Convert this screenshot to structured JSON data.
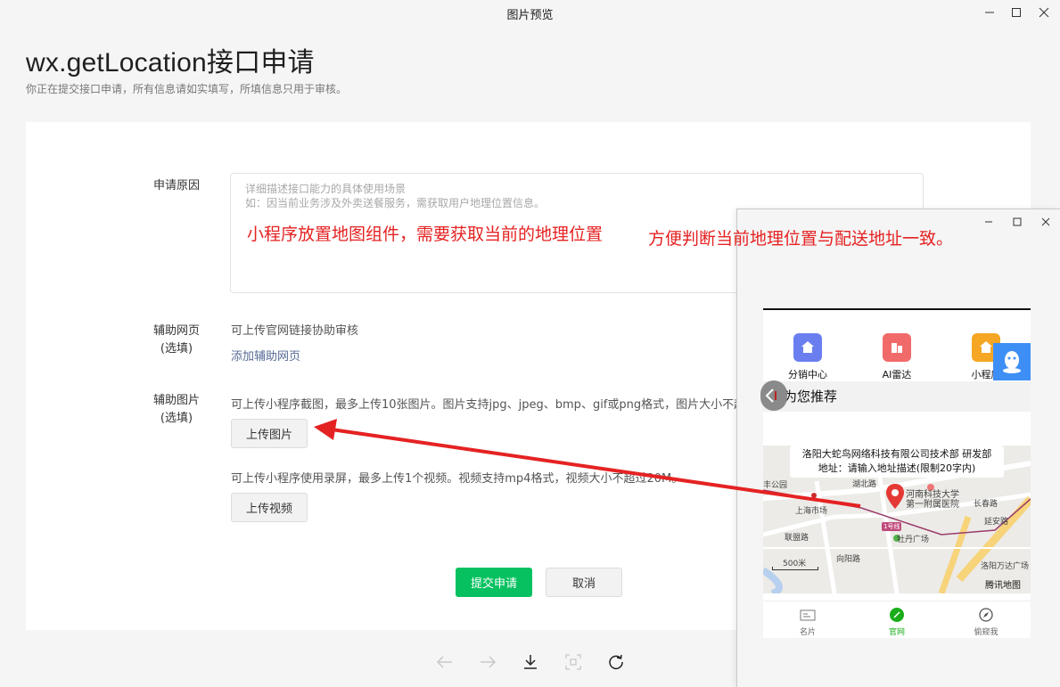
{
  "window": {
    "title": "图片预览"
  },
  "page": {
    "title": "wx.getLocation接口申请",
    "subtitle": "你正在提交接口申请，所有信息请如实填写，所填信息只用于审核。"
  },
  "form": {
    "reason_label": "申请原因",
    "reason_placeholder_1": "详细描述接口能力的具体使用场景",
    "reason_placeholder_2": "如：因当前业务涉及外卖送餐服务，需获取用户地理位置信息。",
    "reason_value_1": "小程序放置地图组件，需要获取当前的地理位置",
    "reason_value_2": "方便判断当前地理位置与配送地址一致。",
    "webpage_label_1": "辅助网页",
    "webpage_label_2": "(选填)",
    "webpage_help": "可上传官网链接协助审核",
    "webpage_link": "添加辅助网页",
    "image_label_1": "辅助图片",
    "image_label_2": "(选填)",
    "image_help": "可上传小程序截图，最多上传10张图片。图片支持jpg、jpeg、bmp、gif或png格式，图片大小不超过",
    "upload_image": "上传图片",
    "video_help": "可上传小程序使用录屏，最多上传1个视频。视频支持mp4格式，视频大小不超过20M。",
    "upload_video": "上传视频",
    "submit": "提交申请",
    "cancel": "取消"
  },
  "mini_app": {
    "apps": [
      "分销中心",
      "AI雷达",
      "小程序"
    ],
    "recommend_title": "为您推荐",
    "map_popup_line1": "洛阳大蛇鸟网络科技有限公司技术部 研发部",
    "map_popup_line2": "地址：请输入地址描述(限制20字内)",
    "map_labels": [
      "湖北路",
      "河南科技大学",
      "第一附属医院",
      "上海市场",
      "长春路",
      "牡丹广场",
      "联盟路",
      "延安路",
      "洛阳万达广场",
      "向阳路",
      "丰公园",
      "腾讯地图",
      "500米",
      "1号线"
    ],
    "tabs": [
      "名片",
      "官网",
      "偷窥我"
    ]
  },
  "colors": {
    "primary_green": "#07c160",
    "annotation_red": "#e52222",
    "link_blue": "#576b95"
  }
}
